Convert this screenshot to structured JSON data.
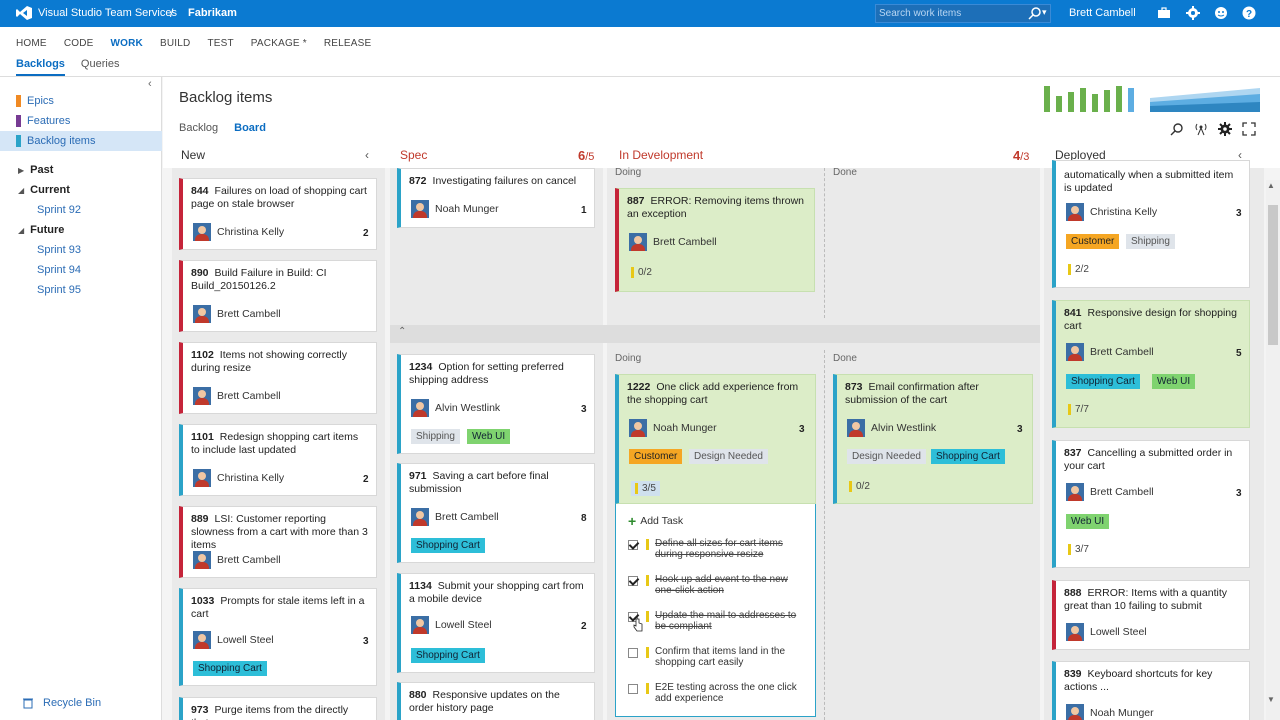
{
  "topbar": {
    "brand": "Visual Studio Team Services",
    "separator": "/",
    "account": "Fabrikam",
    "search_placeholder": "Search work items",
    "user": "Brett Cambell"
  },
  "hubs": [
    "HOME",
    "CODE",
    "WORK",
    "BUILD",
    "TEST",
    "PACKAGE *",
    "RELEASE"
  ],
  "subnav": [
    "Backlogs",
    "Queries"
  ],
  "left": {
    "types": [
      "Epics",
      "Features",
      "Backlog items"
    ],
    "past": "Past",
    "current": "Current",
    "current_sprints": [
      "Sprint 92"
    ],
    "future": "Future",
    "future_sprints": [
      "Sprint 93",
      "Sprint 94",
      "Sprint 95"
    ],
    "recycle": "Recycle Bin"
  },
  "page": {
    "title": "Backlog items",
    "tabs": [
      "Backlog",
      "Board"
    ]
  },
  "columns": {
    "new": "New",
    "spec": "Spec",
    "spec_wip": "6",
    "spec_limit": "/5",
    "dev": "In Development",
    "dev_wip": "4",
    "dev_limit": "/3",
    "deployed": "Deployed",
    "doing": "Doing",
    "done": "Done"
  },
  "new_cards": [
    {
      "id": "844",
      "title": "Failures on load of shopping cart page on stale browser",
      "who": "Christina Kelly",
      "est": "2"
    },
    {
      "id": "890",
      "title": "Build Failure in Build: CI Build_20150126.2",
      "who": "Brett Cambell",
      "est": ""
    },
    {
      "id": "1102",
      "title": "Items not showing correctly during resize",
      "who": "Brett Cambell",
      "est": ""
    },
    {
      "id": "1101",
      "title": "Redesign shopping cart items to include last updated",
      "who": "Christina Kelly",
      "est": "2"
    },
    {
      "id": "889",
      "title": "LSI: Customer reporting slowness from a cart with more than 3 items",
      "who": "Brett Cambell",
      "est": ""
    },
    {
      "id": "1033",
      "title": "Prompts for stale items left in a cart",
      "who": "Lowell Steel",
      "est": "3",
      "tag": "Shopping Cart"
    },
    {
      "id": "973",
      "title": "Purge items from the directly that"
    }
  ],
  "spec_cards": [
    {
      "id": "872",
      "title": "Investigating failures on cancel",
      "who": "Noah Munger",
      "est": "1"
    },
    {
      "id": "1234",
      "title": "Option for setting preferred shipping address",
      "who": "Alvin Westlink",
      "est": "3",
      "tags": [
        "Shipping",
        "Web UI"
      ]
    },
    {
      "id": "971",
      "title": "Saving a cart before final submission",
      "who": "Brett Cambell",
      "est": "8",
      "tag": "Shopping Cart"
    },
    {
      "id": "1134",
      "title": "Submit your shopping cart from a mobile device",
      "who": "Lowell Steel",
      "est": "2",
      "tag": "Shopping Cart"
    },
    {
      "id": "880",
      "title": "Responsive updates on the order history page"
    }
  ],
  "dev_cards": [
    {
      "id": "887",
      "title": "ERROR: Removing items thrown an exception",
      "who": "Brett Cambell",
      "progress": "0/2"
    },
    {
      "id": "1222",
      "title": "One click add experience from the shopping cart",
      "who": "Noah Munger",
      "est": "3",
      "tags": [
        "Customer",
        "Design Needed"
      ],
      "progress": "3/5"
    },
    {
      "id": "873",
      "title": "Email confirmation after submission of the cart",
      "who": "Alvin Westlink",
      "est": "3",
      "tags": [
        "Design Needed",
        "Shopping Cart"
      ],
      "progress": "0/2"
    }
  ],
  "add_task": "Add Task",
  "tasks": [
    {
      "text": "Define all sizes for cart items during responsive resize",
      "done": true
    },
    {
      "text": "Hook up add event to the new one-click action",
      "done": true
    },
    {
      "text": "Update the mail to addresses to be compliant",
      "done": true
    },
    {
      "text": "Confirm that items land in the shopping cart easily",
      "done": false
    },
    {
      "text": "E2E testing across the one click add experience",
      "done": false
    }
  ],
  "deployed_cards": [
    {
      "title": "automatically when a submitted item is updated",
      "who": "Christina Kelly",
      "est": "3",
      "tags": [
        "Customer",
        "Shipping"
      ],
      "progress": "2/2"
    },
    {
      "id": "841",
      "title": "Responsive design for shopping cart",
      "who": "Brett Cambell",
      "est": "5",
      "tags": [
        "Shopping Cart",
        "Web UI"
      ],
      "progress": "7/7"
    },
    {
      "id": "837",
      "title": "Cancelling a submitted order in your cart",
      "who": "Brett Cambell",
      "est": "3",
      "tags": [
        "Web UI"
      ],
      "progress": "3/7"
    },
    {
      "id": "888",
      "title": "ERROR: Items with a quantity great than 10 failing to submit",
      "who": "Lowell Steel"
    },
    {
      "id": "839",
      "title": "Keyboard shortcuts for key actions ...",
      "who": "Noah Munger"
    }
  ],
  "colors": {
    "accent": "#0b7ad1",
    "bug": "#c5243a",
    "pbi": "#2ba3c8",
    "epic": "#f08a24",
    "feature": "#773b93",
    "done_green": "#dcedc8"
  }
}
